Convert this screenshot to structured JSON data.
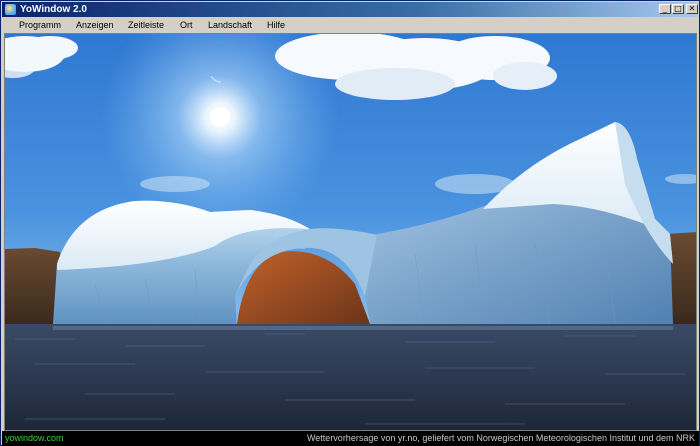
{
  "window": {
    "title": "YoWindow 2.0",
    "controls": {
      "minimize_glyph": "_",
      "maximize_glyph": "□",
      "close_glyph": "✕"
    }
  },
  "menu": {
    "items": [
      {
        "label": "Programm"
      },
      {
        "label": "Anzeigen"
      },
      {
        "label": "Zeitleiste"
      },
      {
        "label": "Ort"
      },
      {
        "label": "Landschaft"
      },
      {
        "label": "Hilfe"
      }
    ]
  },
  "scene": {
    "subject": "iceberg-arch-over-sea",
    "sky_color": "#3d86d8",
    "sea_color": "#27344c"
  },
  "status": {
    "website": "yowindow.com",
    "attribution": "Wettervorhersage von yr.no, geliefert vom Norwegischen Meteorologischen Institut und dem NRK"
  }
}
